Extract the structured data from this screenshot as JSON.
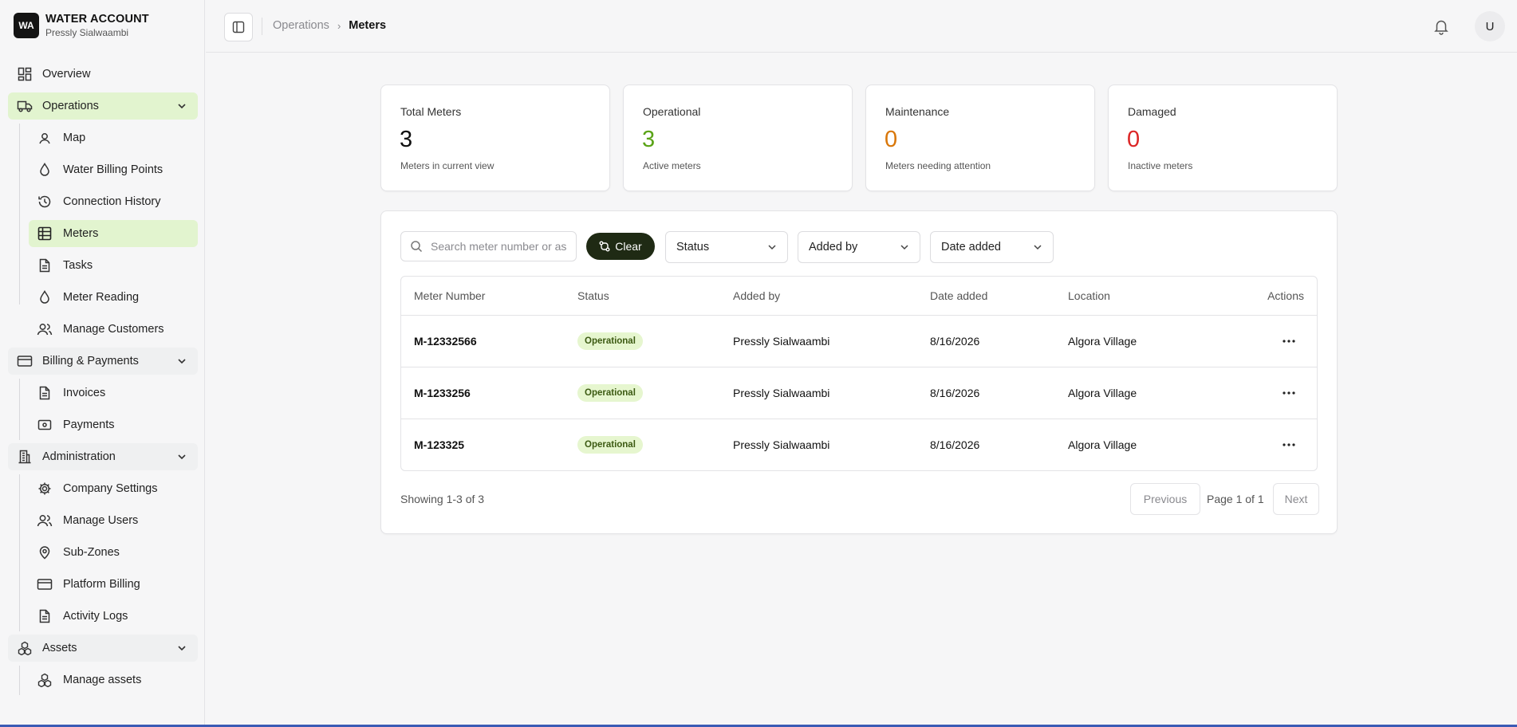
{
  "brand": {
    "logo": "WA",
    "title": "WATER ACCOUNT",
    "subtitle": "Pressly Sialwaambi"
  },
  "nav": {
    "overview": "Overview",
    "operations": {
      "label": "Operations",
      "items": [
        "Map",
        "Water Billing Points",
        "Connection History",
        "Meters",
        "Tasks",
        "Meter Reading",
        "Manage Customers"
      ]
    },
    "billing": {
      "label": "Billing & Payments",
      "items": [
        "Invoices",
        "Payments"
      ]
    },
    "administration": {
      "label": "Administration",
      "items": [
        "Company Settings",
        "Manage Users",
        "Sub-Zones",
        "Platform Billing",
        "Activity Logs"
      ]
    },
    "assets": {
      "label": "Assets",
      "items": [
        "Manage assets"
      ]
    }
  },
  "header": {
    "breadcrumb_parent": "Operations",
    "breadcrumb_current": "Meters",
    "avatar_initial": "U"
  },
  "stats": [
    {
      "title": "Total Meters",
      "value": "3",
      "caption": "Meters in current view",
      "color": "#111111"
    },
    {
      "title": "Operational",
      "value": "3",
      "caption": "Active meters",
      "color": "#5aa317"
    },
    {
      "title": "Maintenance",
      "value": "0",
      "caption": "Meters needing attention",
      "color": "#d9770a"
    },
    {
      "title": "Damaged",
      "value": "0",
      "caption": "Inactive meters",
      "color": "#dc2626"
    }
  ],
  "filters": {
    "search_placeholder": "Search meter number or as",
    "clear_label": "Clear",
    "status_label": "Status",
    "added_by_label": "Added by",
    "date_added_label": "Date added"
  },
  "table": {
    "columns": [
      "Meter Number",
      "Status",
      "Added by",
      "Date added",
      "Location",
      "Actions"
    ],
    "rows": [
      {
        "meter": "M-12332566",
        "status": "Operational",
        "added_by": "Pressly Sialwaambi",
        "date": "8/16/2026",
        "location": "Algora Village"
      },
      {
        "meter": "M-1233256",
        "status": "Operational",
        "added_by": "Pressly Sialwaambi",
        "date": "8/16/2026",
        "location": "Algora Village"
      },
      {
        "meter": "M-123325",
        "status": "Operational",
        "added_by": "Pressly Sialwaambi",
        "date": "8/16/2026",
        "location": "Algora Village"
      }
    ]
  },
  "pagination": {
    "showing": "Showing 1-3 of 3",
    "previous": "Previous",
    "page_info": "Page 1 of 1",
    "next": "Next"
  },
  "colors": {
    "accent_light": "#e2f4cf",
    "accent_dark": "#1f2a14",
    "badge_bg": "#e6f6cf",
    "badge_text": "#3c5a12"
  }
}
